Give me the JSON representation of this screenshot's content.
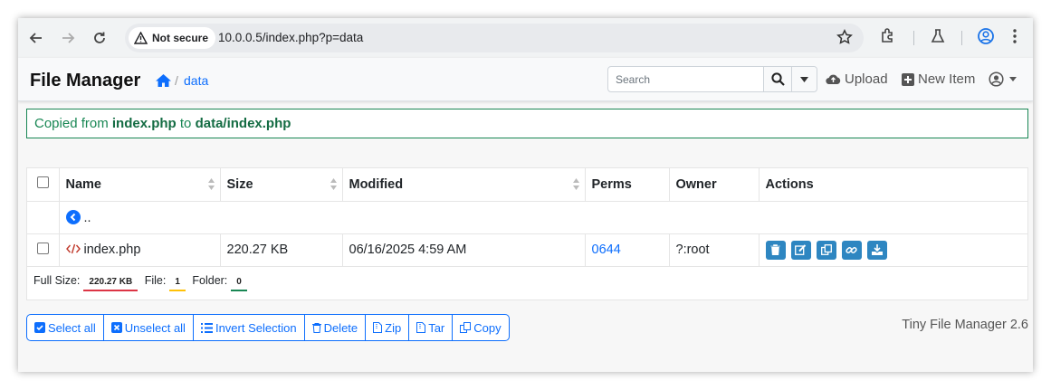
{
  "browser": {
    "not_secure": "Not secure",
    "url": "10.0.0.5/index.php?p=data"
  },
  "app": {
    "brand": "File Manager",
    "breadcrumb_sep": "/",
    "breadcrumb_folder": "data",
    "search_placeholder": "Search",
    "upload_label": "Upload",
    "new_item_label": "New Item"
  },
  "alert": {
    "prefix": "Copied from ",
    "source": "index.php",
    "middle": " to ",
    "target": "data/index.php"
  },
  "table": {
    "headers": {
      "name": "Name",
      "size": "Size",
      "modified": "Modified",
      "perms": "Perms",
      "owner": "Owner",
      "actions": "Actions"
    },
    "parent_label": "..",
    "rows": [
      {
        "name": "index.php",
        "size": "220.27 KB",
        "modified": "06/16/2025 4:59 AM",
        "perms": "0644",
        "owner": "?:root"
      }
    ],
    "footer": {
      "full_size_label": "Full Size:",
      "full_size_value": "220.27 KB",
      "file_label": "File:",
      "file_value": "1",
      "folder_label": "Folder:",
      "folder_value": "0"
    }
  },
  "toolbar": {
    "select_all": "Select all",
    "unselect_all": "Unselect all",
    "invert": "Invert Selection",
    "delete": "Delete",
    "zip": "Zip",
    "tar": "Tar",
    "copy": "Copy"
  },
  "version": "Tiny File Manager 2.6",
  "colors": {
    "accent": "#0d6efd",
    "success": "#198754",
    "action_button": "#2e86c1"
  }
}
